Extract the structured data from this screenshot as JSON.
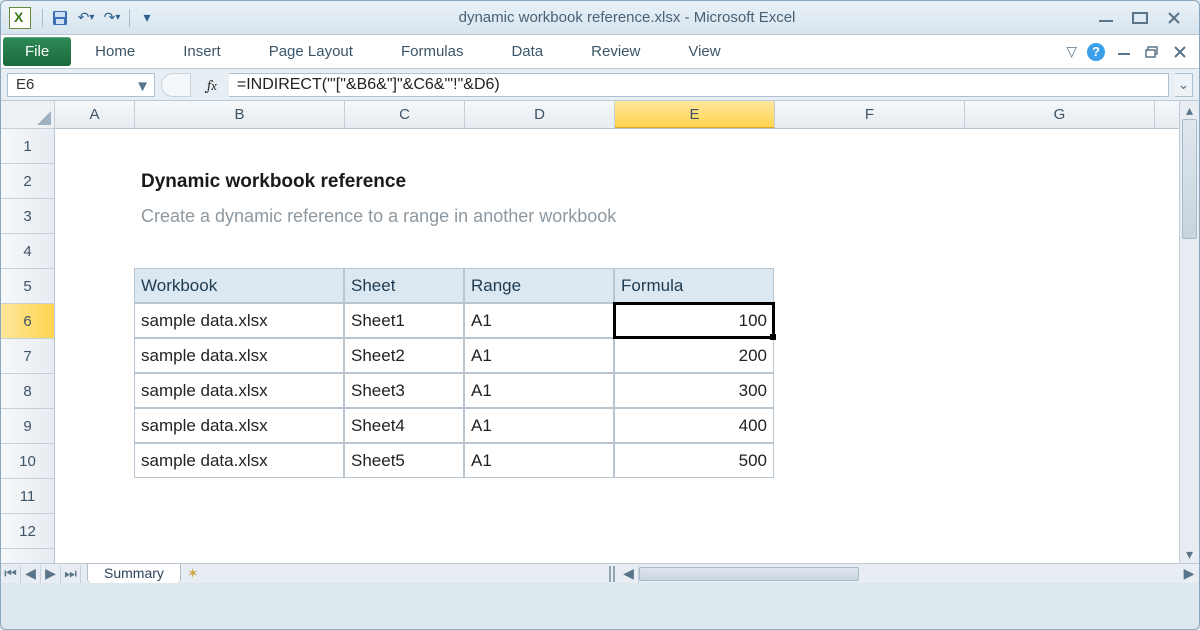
{
  "window": {
    "title": "dynamic workbook reference.xlsx  -  Microsoft Excel"
  },
  "ribbon": {
    "file": "File",
    "tabs": [
      "Home",
      "Insert",
      "Page Layout",
      "Formulas",
      "Data",
      "Review",
      "View"
    ]
  },
  "namebox": "E6",
  "formula": "=INDIRECT(\"'[\"&B6&\"]\"&C6&\"'!\"&D6)",
  "columns": [
    "A",
    "B",
    "C",
    "D",
    "E",
    "F",
    "G"
  ],
  "rows": [
    "1",
    "2",
    "3",
    "4",
    "5",
    "6",
    "7",
    "8",
    "9",
    "10",
    "11",
    "12"
  ],
  "active": {
    "col": "E",
    "row": "6"
  },
  "content": {
    "title": "Dynamic workbook reference",
    "subtitle": "Create a dynamic reference to a range in another workbook",
    "headers": {
      "workbook": "Workbook",
      "sheet": "Sheet",
      "range": "Range",
      "formula": "Formula"
    },
    "data": [
      {
        "workbook": "sample data.xlsx",
        "sheet": "Sheet1",
        "range": "A1",
        "formula": "100"
      },
      {
        "workbook": "sample data.xlsx",
        "sheet": "Sheet2",
        "range": "A1",
        "formula": "200"
      },
      {
        "workbook": "sample data.xlsx",
        "sheet": "Sheet3",
        "range": "A1",
        "formula": "300"
      },
      {
        "workbook": "sample data.xlsx",
        "sheet": "Sheet4",
        "range": "A1",
        "formula": "400"
      },
      {
        "workbook": "sample data.xlsx",
        "sheet": "Sheet5",
        "range": "A1",
        "formula": "500"
      }
    ]
  },
  "sheet_tab": "Summary",
  "colWidths": {
    "A": 80,
    "B": 210,
    "C": 120,
    "D": 150,
    "E": 160,
    "F": 190,
    "G": 190
  }
}
